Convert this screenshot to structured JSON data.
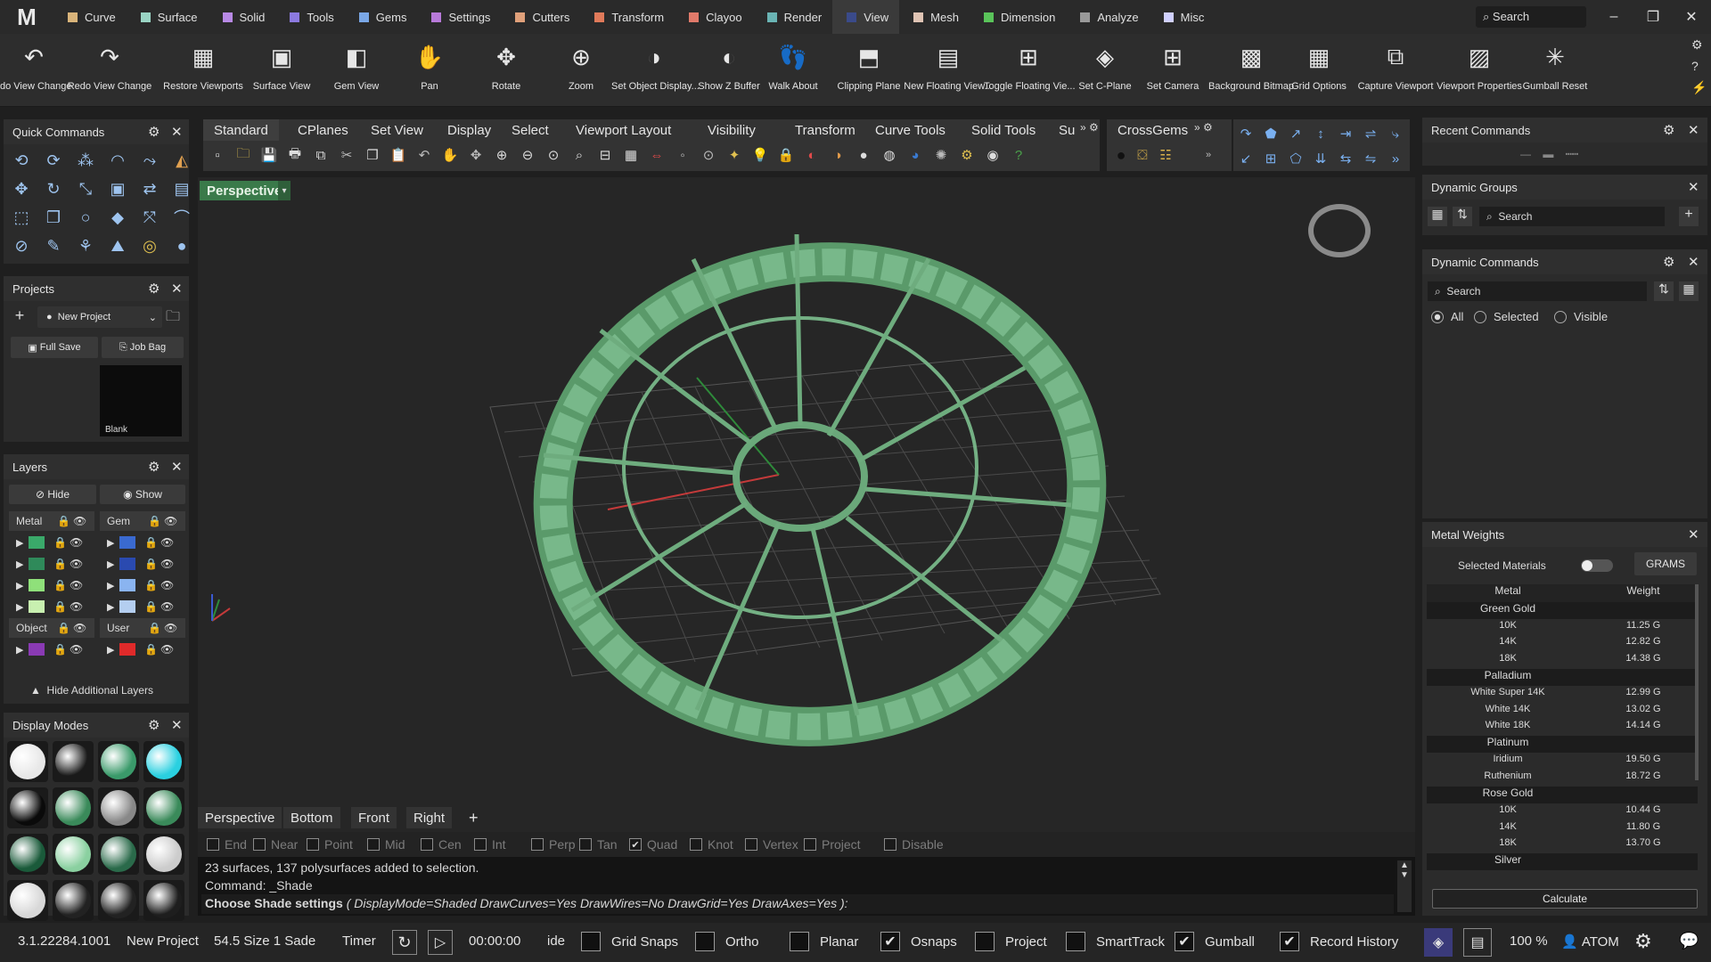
{
  "menu": {
    "logo": "M",
    "tabs": [
      {
        "label": "Curve",
        "color": "#d9b47a"
      },
      {
        "label": "Surface",
        "color": "#9ad4c4"
      },
      {
        "label": "Solid",
        "color": "#b889e6"
      },
      {
        "label": "Tools",
        "color": "#8c7ae0"
      },
      {
        "label": "Gems",
        "color": "#7aa7e6"
      },
      {
        "label": "Settings",
        "color": "#b87ad9"
      },
      {
        "label": "Cutters",
        "color": "#e0a07a"
      },
      {
        "label": "Transform",
        "color": "#e07a5a"
      },
      {
        "label": "Clayoo",
        "color": "#e07a6a"
      },
      {
        "label": "Render",
        "color": "#6ab4b4"
      },
      {
        "label": "View",
        "color": "#3a4a8a"
      },
      {
        "label": "Mesh",
        "color": "#e0c4b4"
      },
      {
        "label": "Dimension",
        "color": "#5ac45a"
      },
      {
        "label": "Analyze",
        "color": "#9a9a9a"
      },
      {
        "label": "Misc",
        "color": "#d0d0ff"
      }
    ],
    "search": "Search"
  },
  "ribbon": [
    {
      "label": "do View Change",
      "icon": "↶"
    },
    {
      "label": "Redo View Change",
      "icon": "↷"
    },
    {
      "label": "Restore Viewports",
      "icon": "▦"
    },
    {
      "label": "Surface View",
      "icon": "▣"
    },
    {
      "label": "Gem View",
      "icon": "◧"
    },
    {
      "label": "Pan",
      "icon": "✋"
    },
    {
      "label": "Rotate",
      "icon": "✥"
    },
    {
      "label": "Zoom",
      "icon": "⊕"
    },
    {
      "label": "Set Object Display...",
      "icon": "◑"
    },
    {
      "label": "Show Z Buffer",
      "icon": "◐"
    },
    {
      "label": "Walk About",
      "icon": "👣"
    },
    {
      "label": "Clipping Plane",
      "icon": "⬒"
    },
    {
      "label": "New Floating View...",
      "icon": "▤"
    },
    {
      "label": "Toggle Floating Vie...",
      "icon": "⊞"
    },
    {
      "label": "Set C-Plane",
      "icon": "◈"
    },
    {
      "label": "Set Camera",
      "icon": "⊞"
    },
    {
      "label": "Background Bitmap",
      "icon": "▩"
    },
    {
      "label": "Grid Options",
      "icon": "▦"
    },
    {
      "label": "Capture Viewport",
      "icon": "⧉"
    },
    {
      "label": "Viewport Properties",
      "icon": "▨"
    },
    {
      "label": "Gumball Reset",
      "icon": "✳"
    }
  ],
  "quick_commands": {
    "title": "Quick Commands"
  },
  "projects": {
    "title": "Projects",
    "dropdown": "New Project",
    "full_save": "Full Save",
    "job_bag": "Job Bag",
    "thumb_label": "Blank"
  },
  "layers": {
    "title": "Layers",
    "hide": "Hide",
    "show": "Show",
    "groups": [
      {
        "name": "Metal"
      },
      {
        "name": "Gem"
      },
      {
        "name": "Object"
      },
      {
        "name": "User"
      }
    ],
    "metal_colors": [
      "#3aa96a",
      "#2f8a5a",
      "#8fe07a",
      "#c8f0b0"
    ],
    "gem_colors": [
      "#3a6ad0",
      "#2a4ab0",
      "#8ab4f0",
      "#b4cef0"
    ],
    "object_colors": [
      "#8a3ab4",
      "#b44a5a"
    ],
    "user_colors": [
      "#e02a2a",
      "#3ad03a"
    ],
    "footer": "Hide Additional Layers"
  },
  "display_modes": {
    "title": "Display Modes"
  },
  "toolbar": {
    "tabs": [
      "Standard",
      "CPlanes",
      "Set View",
      "Display",
      "Select",
      "Viewport Layout",
      "Visibility",
      "Transform",
      "Curve Tools",
      "Solid Tools",
      "Su"
    ],
    "crossgems": "CrossGems"
  },
  "viewport": {
    "label": "Perspective",
    "tabs": [
      "Perspective",
      "Bottom",
      "Front",
      "Right"
    ],
    "add": "+"
  },
  "osnaps": [
    {
      "label": "End",
      "checked": false
    },
    {
      "label": "Near",
      "checked": false
    },
    {
      "label": "Point",
      "checked": false
    },
    {
      "label": "Mid",
      "checked": false
    },
    {
      "label": "Cen",
      "checked": false
    },
    {
      "label": "Int",
      "checked": false
    },
    {
      "label": "Perp",
      "checked": false
    },
    {
      "label": "Tan",
      "checked": false
    },
    {
      "label": "Quad",
      "checked": true
    },
    {
      "label": "Knot",
      "checked": false
    },
    {
      "label": "Vertex",
      "checked": false
    },
    {
      "label": "Project",
      "checked": false
    },
    {
      "label": "Disable",
      "checked": false
    }
  ],
  "command": {
    "line1": "23 surfaces, 137 polysurfaces added to selection.",
    "line2": "Command: _Shade",
    "prompt": "Choose Shade settings",
    "options": "( DisplayMode=Shaded  DrawCurves=Yes  DrawWires=No  DrawGrid=Yes  DrawAxes=Yes ):"
  },
  "right": {
    "recent": "Recent Commands",
    "dyn_groups": "Dynamic Groups",
    "dyn_groups_search": "Search",
    "dyn_commands": "Dynamic Commands",
    "dyn_commands_search": "Search",
    "radio": [
      "All",
      "Selected",
      "Visible"
    ]
  },
  "metal_weights": {
    "title": "Metal Weights",
    "selected_materials": "Selected Materials",
    "unit": "GRAMS",
    "col_metal": "Metal",
    "col_weight": "Weight",
    "rows": [
      {
        "type": "head",
        "name": "Green Gold",
        "weight": ""
      },
      {
        "type": "row",
        "name": "10K",
        "weight": "11.25 G"
      },
      {
        "type": "row",
        "name": "14K",
        "weight": "12.82 G"
      },
      {
        "type": "row",
        "name": "18K",
        "weight": "14.38 G"
      },
      {
        "type": "head",
        "name": "Palladium",
        "weight": ""
      },
      {
        "type": "row",
        "name": "White Super 14K",
        "weight": "12.99 G"
      },
      {
        "type": "row",
        "name": "White 14K",
        "weight": "13.02 G"
      },
      {
        "type": "row",
        "name": "White 18K",
        "weight": "14.14 G"
      },
      {
        "type": "head",
        "name": "Platinum",
        "weight": ""
      },
      {
        "type": "row",
        "name": "Iridium",
        "weight": "19.50 G"
      },
      {
        "type": "row",
        "name": "Ruthenium",
        "weight": "18.72 G"
      },
      {
        "type": "head",
        "name": "Rose Gold",
        "weight": ""
      },
      {
        "type": "row",
        "name": "10K",
        "weight": "10.44 G"
      },
      {
        "type": "row",
        "name": "14K",
        "weight": "11.80 G"
      },
      {
        "type": "row",
        "name": "18K",
        "weight": "13.70 G"
      },
      {
        "type": "head",
        "name": "Silver",
        "weight": ""
      }
    ],
    "calculate": "Calculate"
  },
  "status": {
    "version": "3.1.22284.1001",
    "project": "New Project",
    "size": "54.5   Size 1 Sade",
    "timer": "Timer",
    "time": "00:00:00",
    "ide": "ide",
    "toggles": [
      {
        "label": "Grid Snaps",
        "checked": false
      },
      {
        "label": "Ortho",
        "checked": false
      },
      {
        "label": "Planar",
        "checked": false
      },
      {
        "label": "Osnaps",
        "checked": true
      },
      {
        "label": "Project",
        "checked": false
      },
      {
        "label": "SmartTrack",
        "checked": false
      },
      {
        "label": "Gumball",
        "checked": true
      },
      {
        "label": "Record History",
        "checked": true
      }
    ],
    "zoom": "100 %",
    "user": "ATOM"
  }
}
